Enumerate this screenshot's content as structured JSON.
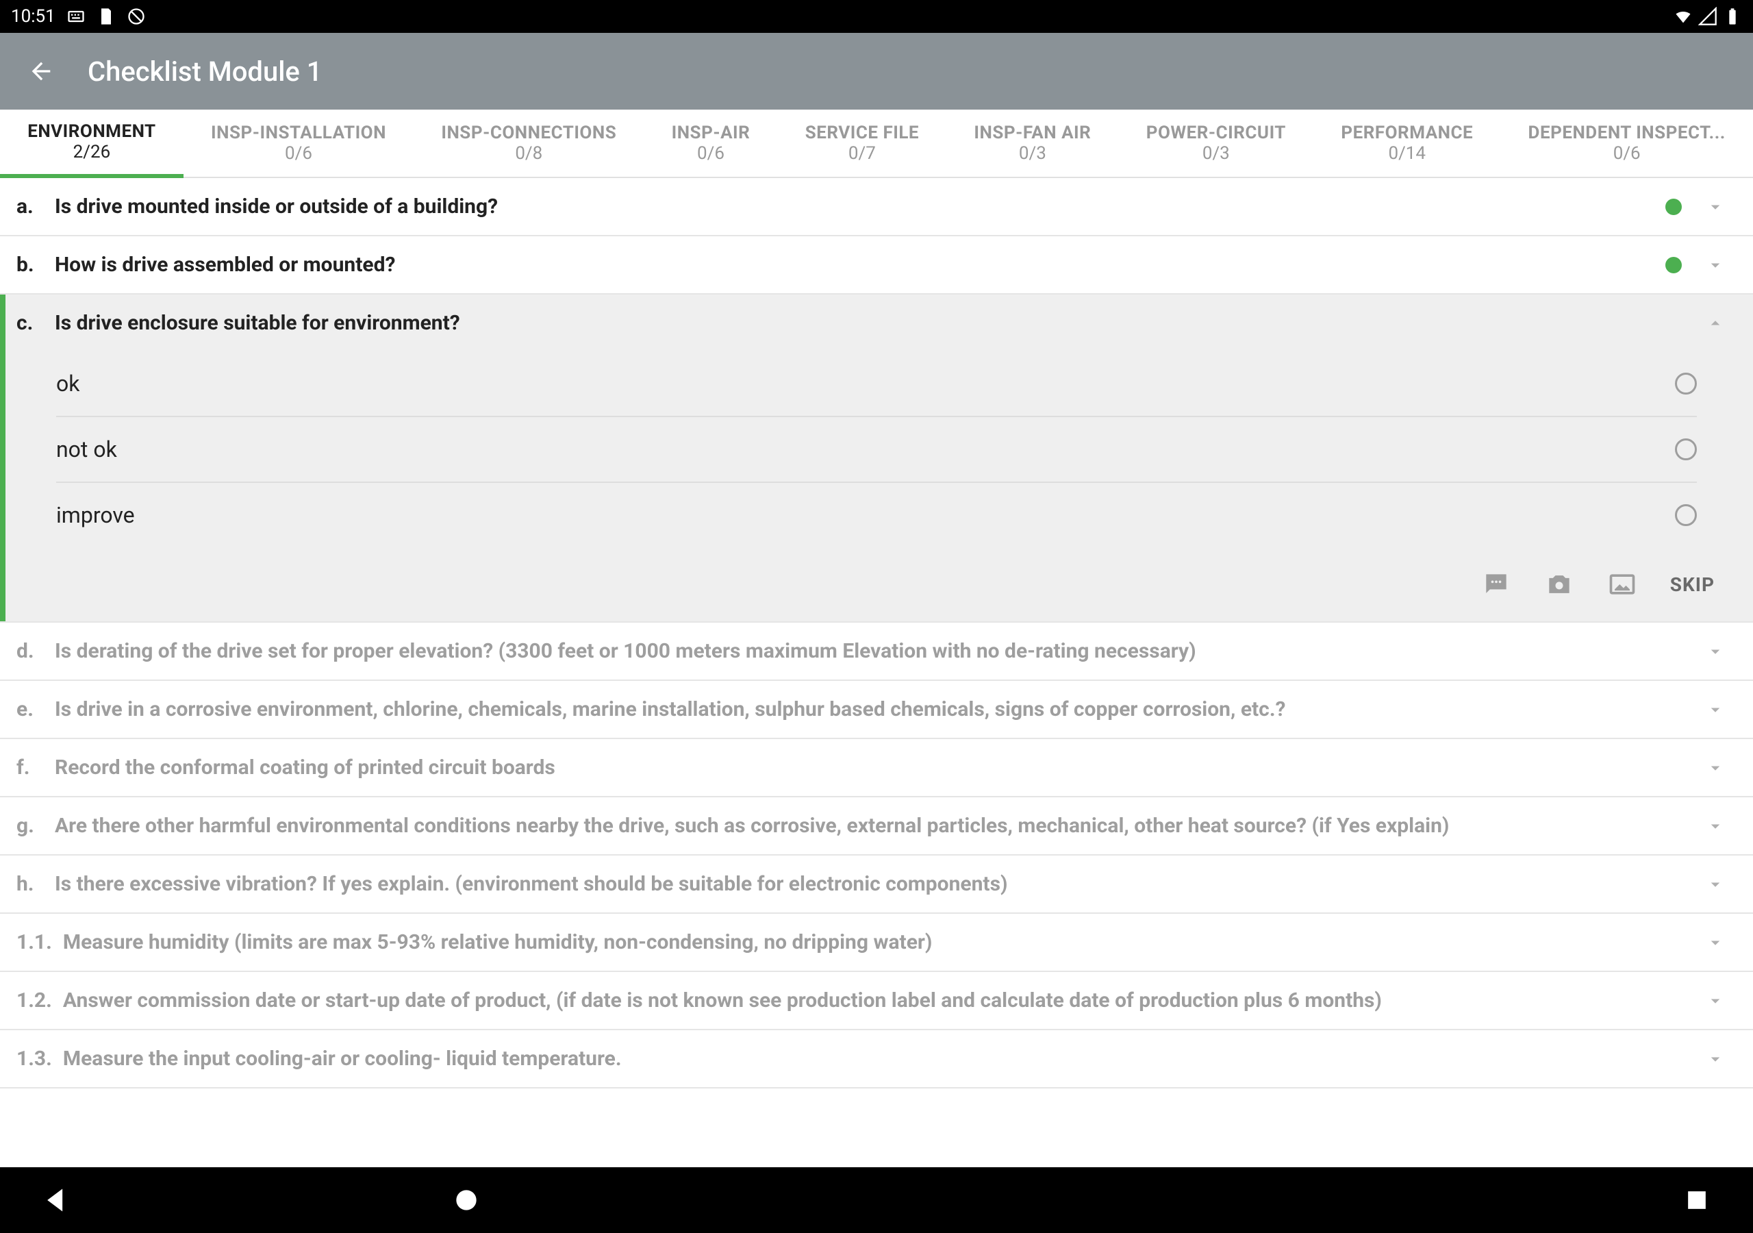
{
  "status": {
    "time": "10:51"
  },
  "header": {
    "title": "Checklist Module 1"
  },
  "tabs": [
    {
      "label": "ENVIRONMENT",
      "count": "2/26",
      "active": true
    },
    {
      "label": "INSP-INSTALLATION",
      "count": "0/6",
      "active": false
    },
    {
      "label": "INSP-CONNECTIONS",
      "count": "0/8",
      "active": false
    },
    {
      "label": "INSP-AIR",
      "count": "0/6",
      "active": false
    },
    {
      "label": "SERVICE FILE",
      "count": "0/7",
      "active": false
    },
    {
      "label": "INSP-FAN AIR",
      "count": "0/3",
      "active": false
    },
    {
      "label": "POWER-CIRCUIT",
      "count": "0/3",
      "active": false
    },
    {
      "label": "PERFORMANCE",
      "count": "0/14",
      "active": false
    },
    {
      "label": "DEPENDENT INSPECT...",
      "count": "0/6",
      "active": false
    }
  ],
  "questions": [
    {
      "letter": "a.",
      "text": "Is drive mounted inside or outside of a building?",
      "answered": true,
      "expanded": false,
      "dim": false
    },
    {
      "letter": "b.",
      "text": "How is drive assembled or mounted?",
      "answered": true,
      "expanded": false,
      "dim": false
    },
    {
      "letter": "c.",
      "text": "Is drive enclosure suitable for environment?",
      "answered": false,
      "expanded": true,
      "dim": false,
      "options": [
        "ok",
        "not ok",
        "improve"
      ]
    },
    {
      "letter": "d.",
      "text": "Is derating of the drive set for proper elevation? (3300 feet or 1000 meters maximum Elevation with no de-rating necessary)",
      "answered": false,
      "expanded": false,
      "dim": true
    },
    {
      "letter": "e.",
      "text": "Is drive in a corrosive environment, chlorine, chemicals, marine installation, sulphur based chemicals, signs of copper corrosion, etc.?",
      "answered": false,
      "expanded": false,
      "dim": true
    },
    {
      "letter": "f.",
      "text": "Record the conformal coating of printed circuit boards",
      "answered": false,
      "expanded": false,
      "dim": true
    },
    {
      "letter": "g.",
      "text": "Are there other harmful environmental conditions nearby the drive, such as corrosive, external particles, mechanical, other heat source? (if Yes explain)",
      "answered": false,
      "expanded": false,
      "dim": true
    },
    {
      "letter": "h.",
      "text": "Is there excessive vibration? If yes explain. (environment should be suitable for electronic components)",
      "answered": false,
      "expanded": false,
      "dim": true
    },
    {
      "letter": "1.1.",
      "text": "Measure humidity (limits are max 5-93% relative humidity, non-condensing, no dripping water)",
      "answered": false,
      "expanded": false,
      "dim": true
    },
    {
      "letter": "1.2.",
      "text": "Answer commission date or start-up date of product, (if date is not known see production label and calculate date of production plus 6 months)",
      "answered": false,
      "expanded": false,
      "dim": true
    },
    {
      "letter": "1.3.",
      "text": "Measure the input cooling-air or cooling- liquid temperature.",
      "answered": false,
      "expanded": false,
      "dim": true
    }
  ],
  "actions": {
    "skip": "SKIP"
  }
}
